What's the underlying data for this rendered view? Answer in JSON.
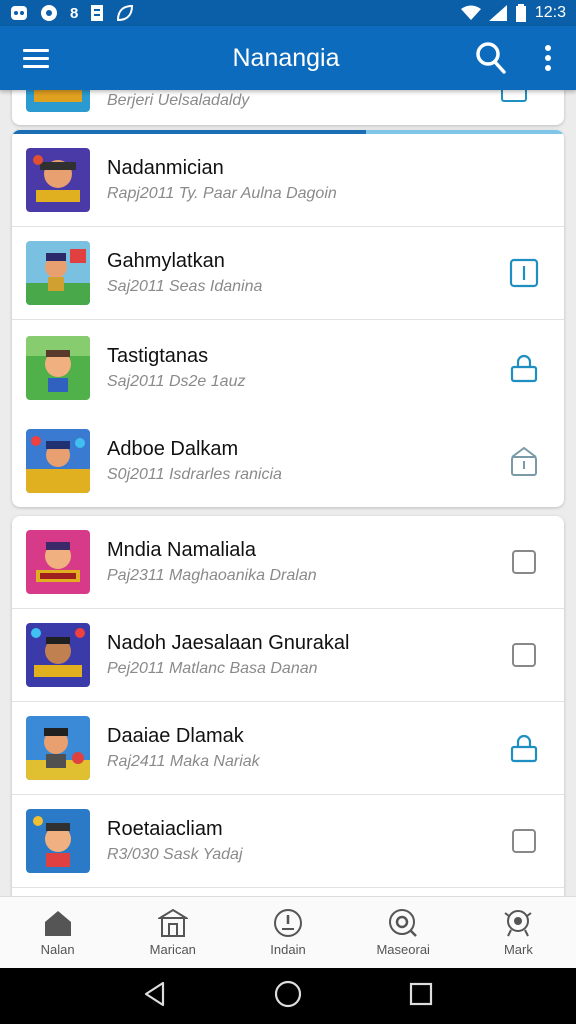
{
  "status_bar": {
    "time": "12:3",
    "left_icons": [
      "notification-icon",
      "sync-icon",
      "app-icon",
      "file-icon",
      "leaf-icon"
    ]
  },
  "app_bar": {
    "title": "Nanangia"
  },
  "partial_row": {
    "subtitle": "Berjeri Uelsaladaldy"
  },
  "list_group_1": [
    {
      "title": "Nadanmician",
      "subtitle": "Rapj2011 Ty. Paar Aulna Dagoin",
      "action": "none",
      "thumb_color": "#4a3aa8"
    },
    {
      "title": "Gahmylatkan",
      "subtitle": "Saj2011 Seas Idanina",
      "action": "info",
      "thumb_color": "#48a84a"
    },
    {
      "title": "Tastigtanas",
      "subtitle": "Saj2011 Ds2e 1auz",
      "action": "lock",
      "thumb_color": "#3a9a3a"
    },
    {
      "title": "Adboe Dalkam",
      "subtitle": "S0j2011 Isdrarles ranicia",
      "action": "lock-outline",
      "thumb_color": "#e0b020"
    }
  ],
  "list_group_2": [
    {
      "title": "Mndia Namaliala",
      "subtitle": "Paj2311 Maghaoanika Dralan",
      "action": "checkbox",
      "thumb_color": "#d83a8a"
    },
    {
      "title": "Nadoh Jaesalaan Gnurakal",
      "subtitle": "Pej2011 Matlanc Basa Danan",
      "action": "checkbox",
      "thumb_color": "#3a3aa8"
    },
    {
      "title": "Daaiae Dlamak",
      "subtitle": "Raj2411 Maka Nariak",
      "action": "lock",
      "thumb_color": "#3a8ad8"
    },
    {
      "title": "Roetaiacliam",
      "subtitle": "R3/030 Sask Yadaj",
      "action": "checkbox",
      "thumb_color": "#2a7ac8"
    }
  ],
  "bottom_nav": [
    {
      "label": "Nalan",
      "icon": "home-icon"
    },
    {
      "label": "Marican",
      "icon": "store-icon"
    },
    {
      "label": "Indain",
      "icon": "alert-icon"
    },
    {
      "label": "Maseorai",
      "icon": "search-circle-icon"
    },
    {
      "label": "Mark",
      "icon": "badge-icon"
    }
  ],
  "colors": {
    "primary": "#0d6bbd",
    "accent": "#1e8fc0",
    "icon_grey": "#888888"
  }
}
